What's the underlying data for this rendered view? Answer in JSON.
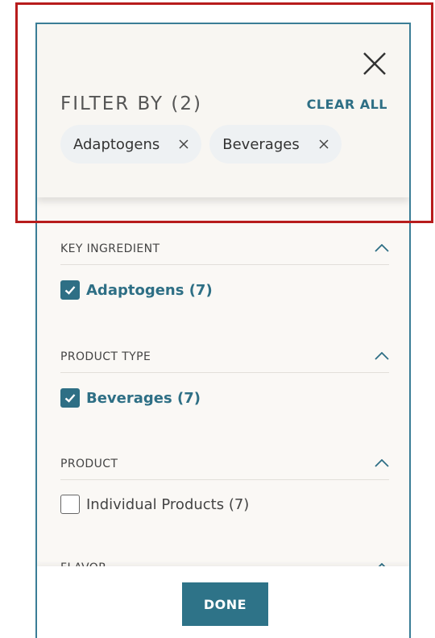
{
  "header": {
    "title": "FILTER BY (2)",
    "clear_all_label": "CLEAR ALL",
    "chips": [
      {
        "label": "Adaptogens"
      },
      {
        "label": "Beverages"
      }
    ]
  },
  "sections": [
    {
      "title": "KEY INGREDIENT",
      "options": [
        {
          "label": "Adaptogens (7)",
          "checked": true
        }
      ]
    },
    {
      "title": "PRODUCT TYPE",
      "options": [
        {
          "label": "Beverages (7)",
          "checked": true
        }
      ]
    },
    {
      "title": "PRODUCT",
      "options": [
        {
          "label": "Individual Products (7)",
          "checked": false
        }
      ]
    },
    {
      "title": "FLAVOR",
      "options": []
    }
  ],
  "footer": {
    "done_label": "DONE"
  },
  "colors": {
    "accent": "#2e6f85",
    "outline": "#b71c1c",
    "panel_border": "#3a7d96"
  },
  "icons": {
    "close": "close-icon",
    "chip_remove": "x-icon",
    "collapse": "chevron-up-icon",
    "check": "checkmark-icon"
  }
}
